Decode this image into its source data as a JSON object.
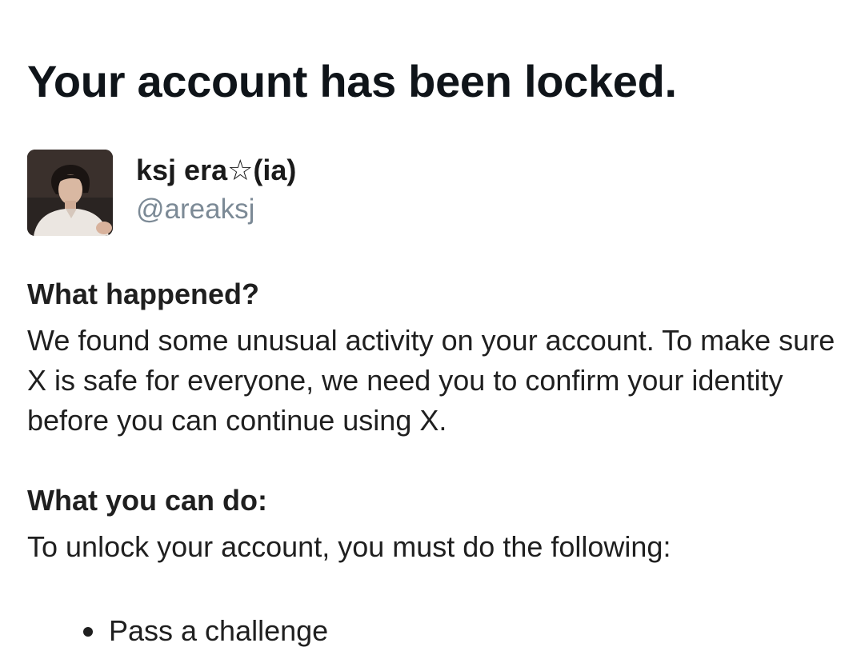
{
  "page": {
    "title": "Your account has been locked."
  },
  "account": {
    "display_name": "ksj era☆(ia)",
    "handle": "@areaksj",
    "avatar_icon": "profile-photo"
  },
  "sections": [
    {
      "heading": "What happened?",
      "body": "We found some unusual activity on your account. To make sure X is safe for everyone, we need you to confirm your identity before you can continue using X."
    },
    {
      "heading": "What you can do:",
      "body": "To unlock your account, you must do the following:"
    }
  ],
  "steps": [
    {
      "label": "Pass a challenge"
    }
  ],
  "colors": {
    "text": "#1f1f1f",
    "title": "#0f1419",
    "handle": "#7c8a96",
    "background": "#ffffff"
  }
}
